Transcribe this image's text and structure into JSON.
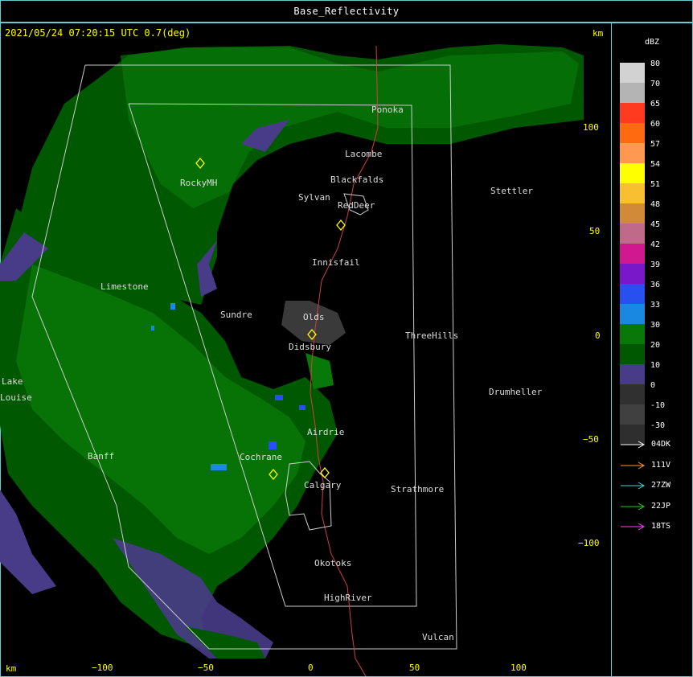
{
  "window": {
    "title": "Base_Reflectivity"
  },
  "header": {
    "timestamp": "2021/05/24 07:20:15 UTC 0.7(deg)",
    "unit_top": "km",
    "unit_bottom": "km"
  },
  "axes": {
    "x_ticks": [
      "−100",
      "−50",
      "0",
      "50",
      "100"
    ],
    "y_ticks": [
      "100",
      "50",
      "0",
      "−50",
      "−100"
    ]
  },
  "places": [
    "Ponoka",
    "Lacombe",
    "Blackfalds",
    "Sylvan",
    "RedDeer",
    "RockyMH",
    "Stettler",
    "Innisfail",
    "Limestone",
    "Sundre",
    "Olds",
    "Didsbury",
    "ThreeHills",
    "Lake",
    "Louise",
    "Drumheller",
    "Airdrie",
    "Banff",
    "Cochrane",
    "Calgary",
    "Strathmore",
    "Okotoks",
    "HighRiver",
    "Vulcan"
  ],
  "legend": {
    "title": "dBZ",
    "scale": [
      {
        "label": "80",
        "color": "#d2d2d2"
      },
      {
        "label": "70",
        "color": "#b4b4b4"
      },
      {
        "label": "65",
        "color": "#ff3a1e"
      },
      {
        "label": "60",
        "color": "#ff6a10"
      },
      {
        "label": "57",
        "color": "#ff9850"
      },
      {
        "label": "54",
        "color": "#ffff00"
      },
      {
        "label": "51",
        "color": "#f8c030"
      },
      {
        "label": "48",
        "color": "#d08a38"
      },
      {
        "label": "45",
        "color": "#c06a8a"
      },
      {
        "label": "42",
        "color": "#d01890"
      },
      {
        "label": "39",
        "color": "#7818c8"
      },
      {
        "label": "36",
        "color": "#2850f0"
      },
      {
        "label": "33",
        "color": "#1888e0"
      },
      {
        "label": "30",
        "color": "#087808"
      },
      {
        "label": "20",
        "color": "#005800"
      },
      {
        "label": "10",
        "color": "#483c88"
      },
      {
        "label": "0",
        "color": "#303030"
      },
      {
        "label": "-10",
        "color": "#404040"
      },
      {
        "label": "-30",
        "color": "#2e2e2e"
      }
    ],
    "tracks": [
      {
        "label": "04DK",
        "color": "#ffffff"
      },
      {
        "label": "111V",
        "color": "#ff9a30"
      },
      {
        "label": "27ZW",
        "color": "#40d8d8"
      },
      {
        "label": "22JP",
        "color": "#20d020"
      },
      {
        "label": "18TS",
        "color": "#ff40ff"
      }
    ]
  }
}
